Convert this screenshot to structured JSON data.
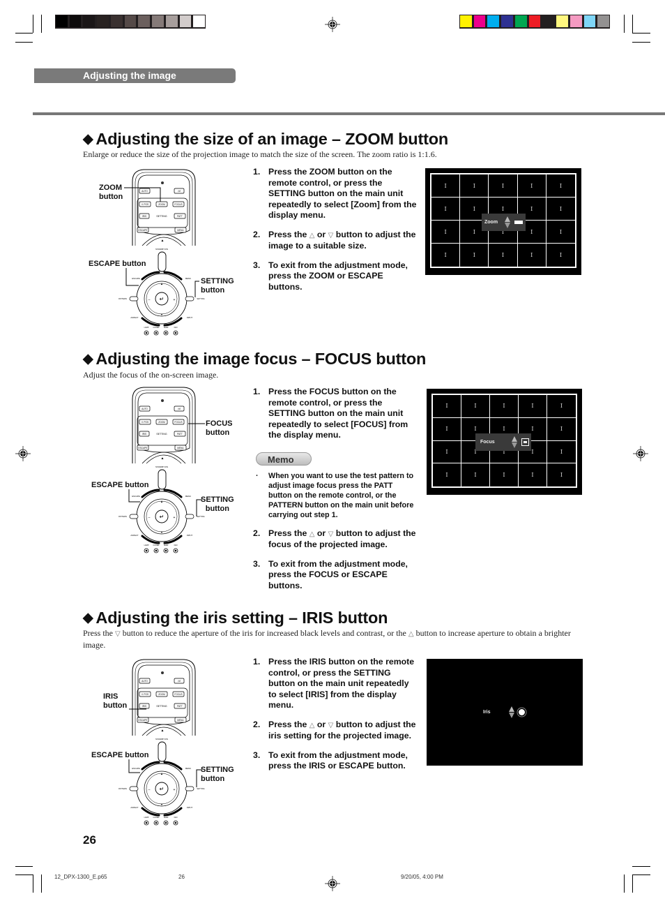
{
  "print_marks": {
    "grayscale_swatches": [
      "#000000",
      "#0d0b0b",
      "#1a1617",
      "#282221",
      "#3a3130",
      "#554a48",
      "#6b5f5d",
      "#857a78",
      "#a79e9c",
      "#d2cccb",
      "#ffffff"
    ],
    "color_swatches": [
      "#fff200",
      "#ec008c",
      "#00aeef",
      "#2e3192",
      "#00a651",
      "#ed1c24",
      "#231f20",
      "#fff77f",
      "#f49ac1",
      "#7fd6f7",
      "#939191"
    ]
  },
  "header": {
    "section_tab": "Adjusting the image"
  },
  "sections": [
    {
      "title": "Adjusting the size of an image – ZOOM button",
      "intro": "Enlarge or reduce the size of the projection image to match the size of the screen. The zoom ratio is 1:1.6.",
      "steps": [
        {
          "num": "1.",
          "text": "Press the ZOOM button on the remote control, or press the SETTING button on the main unit repeatedly to select [Zoom] from the display menu."
        },
        {
          "num": "2.",
          "pre": "Press the ",
          "up": "△",
          "mid": " or ",
          "down": "▽",
          "post": " button to adjust the image to a suitable size."
        },
        {
          "num": "3.",
          "text": "To exit from the adjustment mode, press the ZOOM or ESCAPE buttons."
        }
      ],
      "callouts": {
        "target": "ZOOM\nbutton",
        "escape": "ESCAPE button",
        "setting": "SETTING\nbutton"
      },
      "osd": {
        "label": "Zoom",
        "icon": "zoom-bar-icon"
      }
    },
    {
      "title": "Adjusting the image focus – FOCUS button",
      "intro": "Adjust the focus of the on-screen image.",
      "steps": [
        {
          "num": "1.",
          "text": "Press the FOCUS button on the remote control, or press the SETTING button on the main unit repeatedly to select [FOCUS] from the display menu."
        },
        {
          "num": "2.",
          "pre": "Press the ",
          "up": "△",
          "mid": " or ",
          "down": "▽",
          "post": " button to adjust the  focus of the projected image."
        },
        {
          "num": "3.",
          "text": "To exit from the adjustment mode, press the FOCUS or ESCAPE buttons."
        }
      ],
      "memo": {
        "label": "Memo",
        "bullet": "·",
        "text": "When you want to use the test pattern to adjust image focus press the PATT button on the remote control, or the PATTERN button on the main unit before carrying out step 1."
      },
      "callouts": {
        "target": "FOCUS\nbutton",
        "escape": "ESCAPE button",
        "setting": "SETTING\nbutton"
      },
      "osd": {
        "label": "Focus",
        "icon": "focus-frame-icon"
      }
    },
    {
      "title": "Adjusting the iris setting – IRIS button",
      "intro_pre": "Press the ",
      "intro_down": "▽",
      "intro_mid": " button to reduce the aperture of the iris for increased black levels and contrast, or the ",
      "intro_up": "△",
      "intro_post": " button to increase aperture to obtain a brighter image.",
      "steps": [
        {
          "num": "1.",
          "text": "Press the IRIS button on the remote control, or press the SETTING button on the main unit repeatedly to select [IRIS] from the display menu."
        },
        {
          "num": "2.",
          "pre": " Press the ",
          "up": "△",
          "mid": " or ",
          "down": "▽",
          "post": " button to adjust the  iris setting for the projected image."
        },
        {
          "num": "3.",
          "text": "To exit from the adjustment mode, press the IRIS or ESCAPE button."
        }
      ],
      "callouts": {
        "target": "IRIS\nbutton",
        "escape": "ESCAPE button",
        "setting": "SETTING\nbutton"
      },
      "osd": {
        "label": "Iris",
        "icon": "iris-circle-icon"
      }
    }
  ],
  "remote": {
    "buttons": {
      "auto": "AUTO",
      "power": "⏻/I",
      "vpos": "V. POS",
      "zoom": "ZOOM",
      "focus": "FOCUS",
      "iris": "IRIS",
      "setting": "SETTING",
      "patt": "PATT",
      "escape": "ESCAPE",
      "menu": "MENU"
    },
    "unit": {
      "standby": "STANDBY/ON",
      "escape": "ESCAPE",
      "menu": "MENU",
      "pattern": "PATTERN",
      "setting": "SETTING",
      "aspect": "ASPECT",
      "input": "INPUT",
      "minus": "–",
      "plus": "+",
      "leds": [
        "LAMP",
        "COVER",
        "TEMP",
        "FAN"
      ]
    }
  },
  "pattern_glyph": "I",
  "page_number": "26",
  "footer": {
    "file": "12_DPX-1300_E.p65",
    "page": "26",
    "timestamp": "9/20/05, 4:00 PM"
  }
}
